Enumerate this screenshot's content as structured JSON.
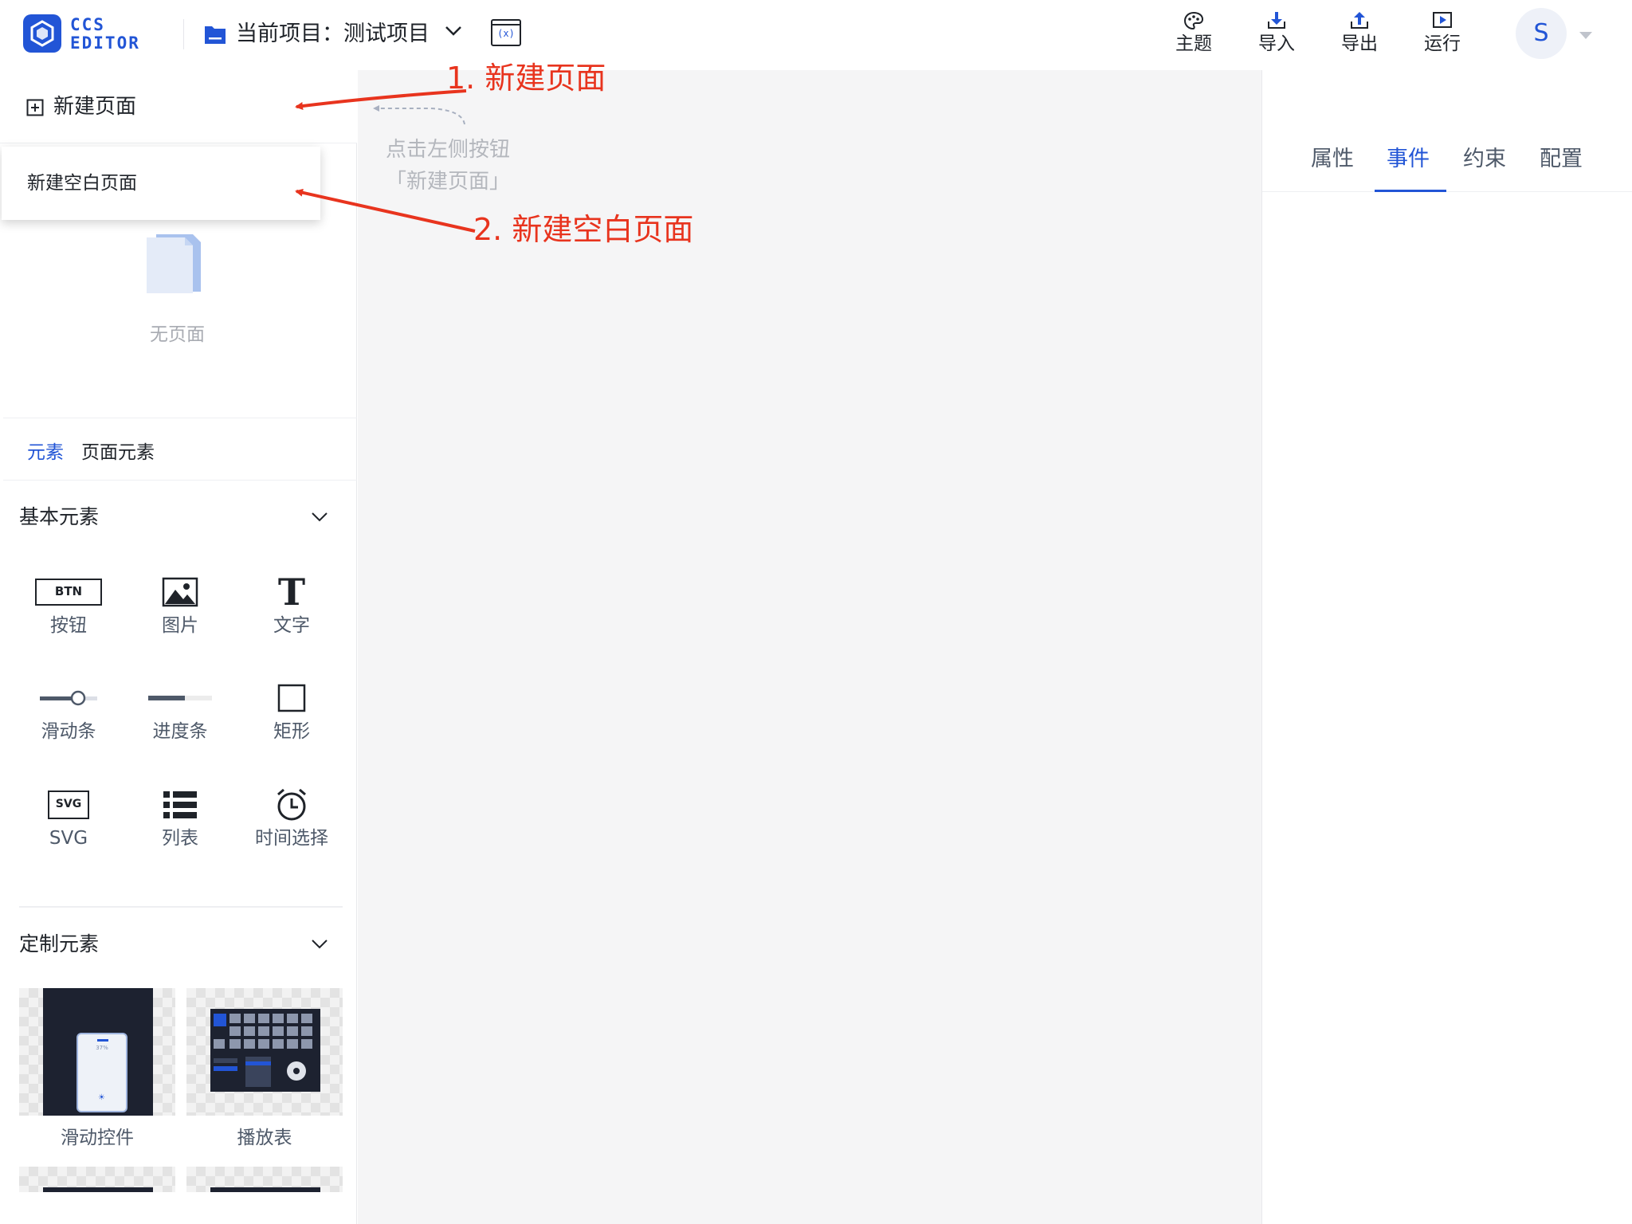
{
  "header": {
    "logo_line1": "CCS",
    "logo_line2": "EDITOR",
    "project_label": "当前项目：测试项目",
    "variables_button": "(x)",
    "tools": [
      {
        "label": "主题",
        "icon": "palette-icon"
      },
      {
        "label": "导入",
        "icon": "import-icon"
      },
      {
        "label": "导出",
        "icon": "export-icon"
      },
      {
        "label": "运行",
        "icon": "run-icon"
      }
    ],
    "avatar_initial": "S"
  },
  "left_panel": {
    "new_page_label": "新建页面",
    "dropdown_option": "新建空白页面",
    "empty_text": "无页面",
    "tabs": [
      "元素",
      "页面元素"
    ],
    "basic_section_title": "基本元素",
    "basic_elements": [
      {
        "label": "按钮",
        "icon": "button-icon",
        "icon_text": "BTN"
      },
      {
        "label": "图片",
        "icon": "image-icon"
      },
      {
        "label": "文字",
        "icon": "text-icon",
        "icon_text": "T"
      },
      {
        "label": "滑动条",
        "icon": "slider-icon"
      },
      {
        "label": "进度条",
        "icon": "progress-bar-icon"
      },
      {
        "label": "矩形",
        "icon": "rectangle-icon"
      },
      {
        "label": "SVG",
        "icon": "svg-icon",
        "icon_text": "SVG"
      },
      {
        "label": "列表",
        "icon": "list-icon"
      },
      {
        "label": "时间选择",
        "icon": "alarm-clock-icon"
      }
    ],
    "custom_section_title": "定制元素",
    "custom_elements": [
      {
        "label": "滑动控件",
        "preview_value": "37%"
      },
      {
        "label": "播放表"
      }
    ]
  },
  "canvas": {
    "hint_line1": "点击左侧按钮",
    "hint_line2": "「新建页面」"
  },
  "annotations": {
    "step1": "1. 新建页面",
    "step2": "2. 新建空白页面",
    "color": "#e8341e"
  },
  "right_panel": {
    "tabs": [
      "属性",
      "事件",
      "约束",
      "配置"
    ],
    "active_tab": "事件"
  },
  "colors": {
    "accent": "#2255d6",
    "annotation": "#e8341e",
    "muted_text": "#a8abb2"
  }
}
